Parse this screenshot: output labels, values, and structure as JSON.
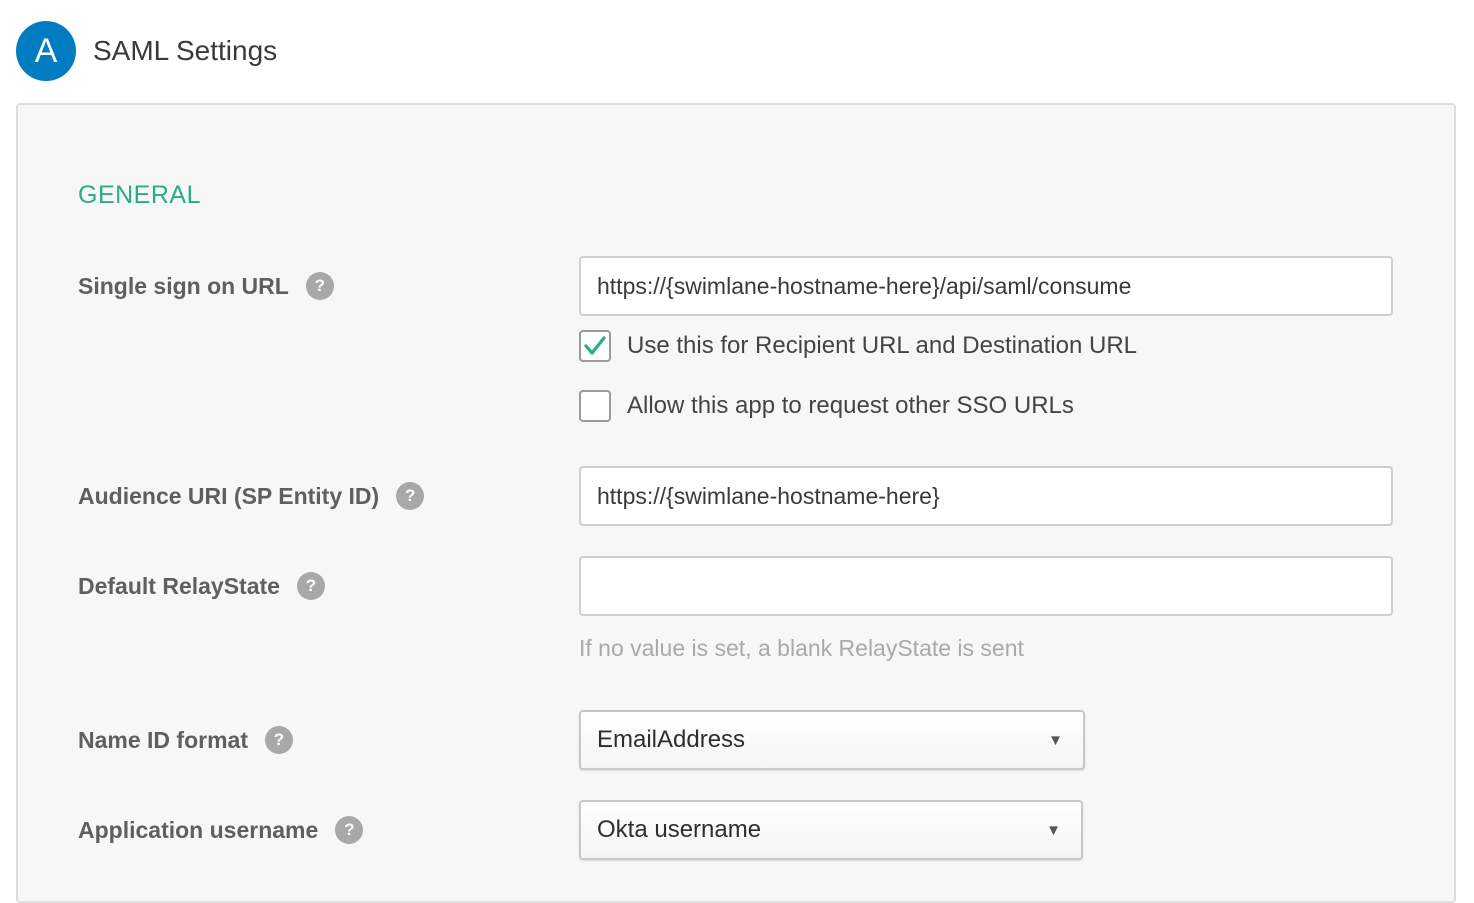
{
  "header": {
    "step_badge": "A",
    "title": "SAML Settings"
  },
  "general": {
    "section_title": "GENERAL",
    "sso_url": {
      "label": "Single sign on URL",
      "value": "https://{swimlane-hostname-here}/api/saml/consume"
    },
    "recipient_checkbox": {
      "label": "Use this for Recipient URL and Destination URL",
      "checked": true
    },
    "other_sso_checkbox": {
      "label": "Allow this app to request other SSO URLs",
      "checked": false
    },
    "audience_uri": {
      "label": "Audience URI (SP Entity ID)",
      "value": "https://{swimlane-hostname-here}"
    },
    "relay_state": {
      "label": "Default RelayState",
      "value": "",
      "hint": "If no value is set, a blank RelayState is sent"
    },
    "name_id_format": {
      "label": "Name ID format",
      "selected": "EmailAddress"
    },
    "app_username": {
      "label": "Application username",
      "selected": "Okta username"
    }
  },
  "icons": {
    "help": "?",
    "caret": "▼"
  },
  "colors": {
    "badge": "#007dc1",
    "section_title": "#2aab8a",
    "check": "#2aab8a"
  }
}
